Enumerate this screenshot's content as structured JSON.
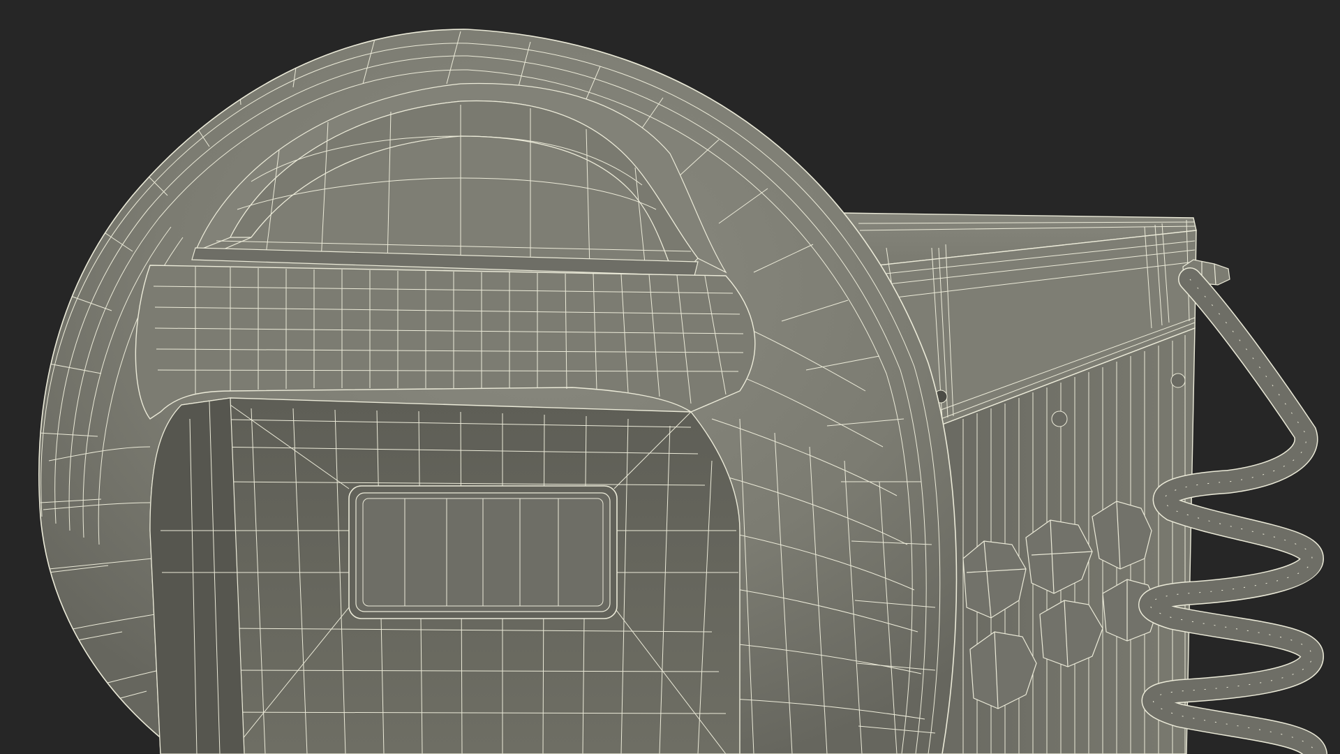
{
  "scene": {
    "subject": "wireframe-3d-model-welding-helmet-and-welder",
    "colors": {
      "background": "#262626",
      "surface_light": "#84847a",
      "surface_mid": "#76766c",
      "surface_dark": "#5c5c54",
      "surface_deep": "#4a4a44",
      "wire": "#ecebd9"
    },
    "icons": [
      "welding-helmet-wireframe",
      "viewing-window-wireframe",
      "welder-machine-wireframe",
      "coiled-cable-wireframe",
      "cable-connector-icon"
    ]
  }
}
